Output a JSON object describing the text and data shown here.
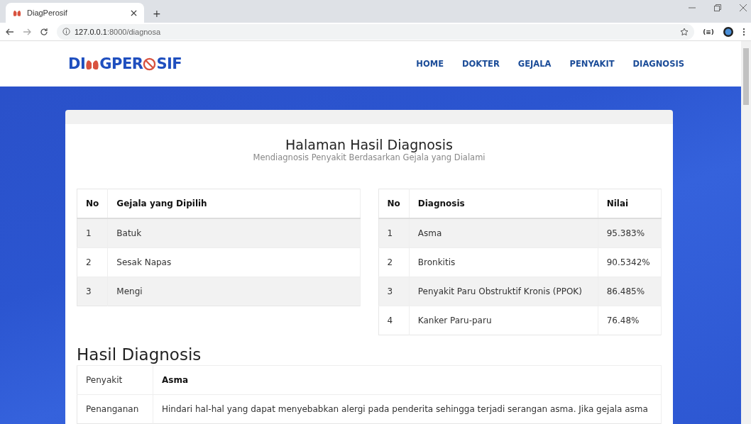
{
  "browser": {
    "tab_title": "DiagPerosif",
    "new_tab": "+",
    "url_host": "127.0.0.1",
    "url_path": ":8000/diagnosa",
    "extension_label": "(≡)"
  },
  "site": {
    "logo": [
      "DI",
      "GPER",
      "SIF"
    ],
    "nav": [
      {
        "label": "HOME"
      },
      {
        "label": "DOKTER"
      },
      {
        "label": "GEJALA"
      },
      {
        "label": "PENYAKIT"
      },
      {
        "label": "DIAGNOSIS"
      }
    ]
  },
  "page": {
    "title": "Halaman Hasil Diagnosis",
    "subtitle": "Mendiagnosis Penyakit Berdasarkan Gejala yang Dialami"
  },
  "symptoms_table": {
    "columns": [
      "No",
      "Gejala yang Dipilih"
    ],
    "rows": [
      [
        "1",
        "Batuk"
      ],
      [
        "2",
        "Sesak Napas"
      ],
      [
        "3",
        "Mengi"
      ]
    ]
  },
  "diagnosis_table": {
    "columns": [
      "No",
      "Diagnosis",
      "Nilai"
    ],
    "rows": [
      [
        "1",
        "Asma",
        "95.383%"
      ],
      [
        "2",
        "Bronkitis",
        "90.5342%"
      ],
      [
        "3",
        "Penyakit Paru Obstruktif Kronis (PPOK)",
        "86.485%"
      ],
      [
        "4",
        "Kanker Paru-paru",
        "76.48%"
      ]
    ]
  },
  "result": {
    "heading": "Hasil Diagnosis",
    "rows": [
      {
        "label": "Penyakit",
        "value": "Asma",
        "kind": "bold"
      },
      {
        "label": "Penanganan",
        "value": "Hindari hal-hal yang dapat menyebabkan alergi pada penderita sehingga terjadi serangan asma. Jika gejala asma",
        "kind": "plain"
      }
    ]
  }
}
